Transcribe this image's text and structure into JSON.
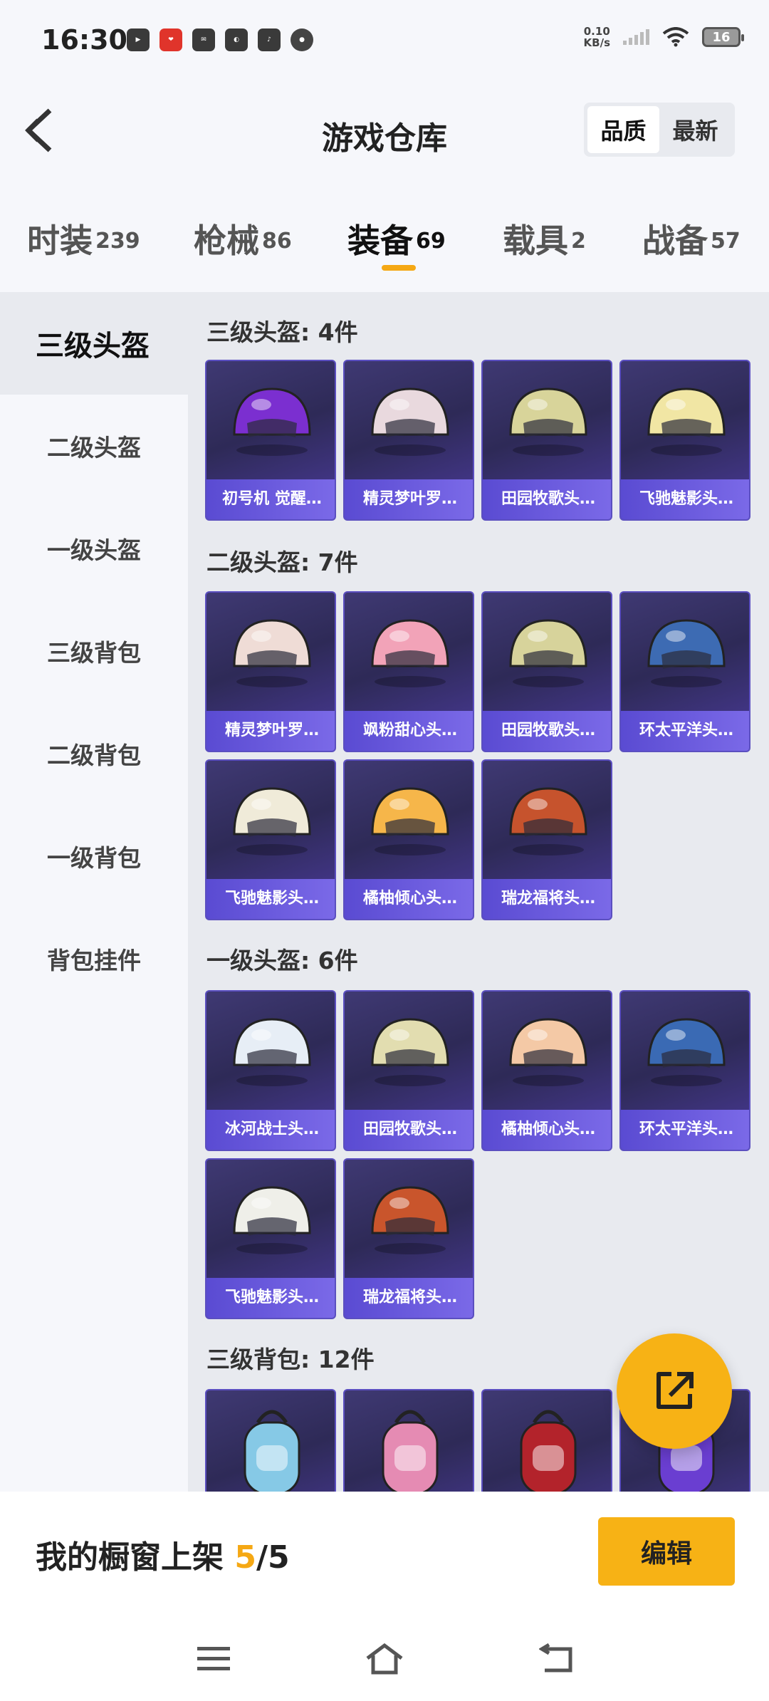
{
  "status_bar": {
    "time": "16:30",
    "app_icons": [
      "youku-icon",
      "pinduoduo-icon",
      "mail-icon",
      "bilibili-icon",
      "tiktok-icon",
      "baidu-maps-icon"
    ],
    "net_speed_value": "0.10",
    "net_speed_unit": "KB/s",
    "battery": "16"
  },
  "header": {
    "title": "游戏仓库",
    "sort_options": [
      "品质",
      "最新"
    ],
    "sort_active": "品质"
  },
  "tabs": [
    {
      "label": "时装",
      "count": "239"
    },
    {
      "label": "枪械",
      "count": "86"
    },
    {
      "label": "装备",
      "count": "69"
    },
    {
      "label": "载具",
      "count": "2"
    },
    {
      "label": "战备",
      "count": "57"
    }
  ],
  "active_tab": "装备",
  "sidebar": {
    "items": [
      "三级头盔",
      "二级头盔",
      "一级头盔",
      "三级背包",
      "二级背包",
      "一级背包",
      "背包挂件"
    ],
    "active": "三级头盔"
  },
  "sections": [
    {
      "title": "三级头盔: 4件",
      "items": [
        {
          "name": "初号机 觉醒…",
          "icon": "helmet-purple-icon",
          "color": "#7b2fd0"
        },
        {
          "name": "精灵梦叶罗…",
          "icon": "helmet-fairy-icon",
          "color": "#e9d9de"
        },
        {
          "name": "田园牧歌头…",
          "icon": "helmet-flower-icon",
          "color": "#d8d49a"
        },
        {
          "name": "飞驰魅影头…",
          "icon": "helmet-racer-icon",
          "color": "#f1e6a4"
        }
      ]
    },
    {
      "title": "二级头盔: 7件",
      "items": [
        {
          "name": "精灵梦叶罗…",
          "icon": "helmet-fairy-icon",
          "color": "#efdcd6"
        },
        {
          "name": "飒粉甜心头…",
          "icon": "helmet-pink-icon",
          "color": "#f2a3b8"
        },
        {
          "name": "田园牧歌头…",
          "icon": "helmet-flower-icon",
          "color": "#d7d39b"
        },
        {
          "name": "环太平洋头…",
          "icon": "helmet-blue-icon",
          "color": "#3d6bb3"
        },
        {
          "name": "飞驰魅影头…",
          "icon": "helmet-racer-icon",
          "color": "#f0ebd9"
        },
        {
          "name": "橘柚倾心头…",
          "icon": "helmet-orange-icon",
          "color": "#f6b64a"
        },
        {
          "name": "瑞龙福将头…",
          "icon": "helmet-dragon-icon",
          "color": "#c6532d"
        }
      ]
    },
    {
      "title": "一级头盔: 6件",
      "items": [
        {
          "name": "冰河战士头…",
          "icon": "helmet-ice-icon",
          "color": "#e7eef6"
        },
        {
          "name": "田园牧歌头…",
          "icon": "helmet-flower-icon",
          "color": "#e2ddb0"
        },
        {
          "name": "橘柚倾心头…",
          "icon": "helmet-orange-icon",
          "color": "#f4c9a6"
        },
        {
          "name": "环太平洋头…",
          "icon": "helmet-blue-icon",
          "color": "#3a6ab4"
        },
        {
          "name": "飞驰魅影头…",
          "icon": "helmet-racer-icon",
          "color": "#efefe9"
        },
        {
          "name": "瑞龙福将头…",
          "icon": "helmet-dragon-icon",
          "color": "#c9552c"
        }
      ]
    },
    {
      "title": "三级背包: 12件",
      "items": [
        {
          "name": "",
          "icon": "backpack-fish-icon",
          "color": "#86c9e6"
        },
        {
          "name": "",
          "icon": "backpack-pink-icon",
          "color": "#e58bb3"
        },
        {
          "name": "",
          "icon": "backpack-red-icon",
          "color": "#b3232b"
        },
        {
          "name": "",
          "icon": "backpack-purple-icon",
          "color": "#6a3ed1"
        }
      ]
    }
  ],
  "bottom_bar": {
    "showcase_label": "我的橱窗上架",
    "showcase_current": "5",
    "showcase_sep": "/",
    "showcase_total": "5",
    "edit_label": "编辑"
  },
  "nav_bar": [
    "menu-icon",
    "home-icon",
    "back-icon"
  ],
  "colors": {
    "accent": "#f7b215",
    "card_label": "#6a5ae0"
  }
}
